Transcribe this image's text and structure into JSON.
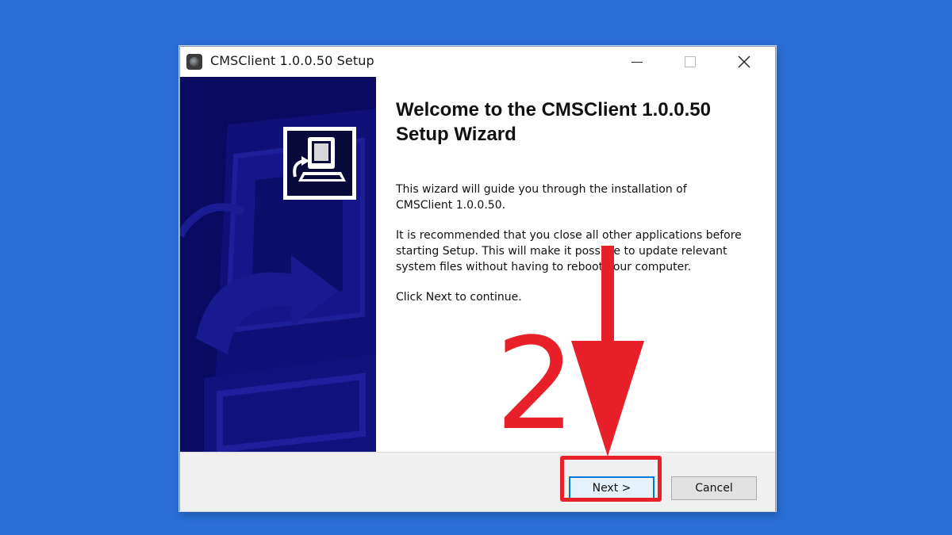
{
  "window": {
    "title": "CMSClient 1.0.0.50 Setup",
    "controls": {
      "minimize": "—",
      "close": "✕"
    }
  },
  "content": {
    "heading_line1": "Welcome to the CMSClient 1.0.0.50",
    "heading_line2": "Setup Wizard",
    "paragraph1": "This wizard will guide you through the installation of CMSClient 1.0.0.50.",
    "paragraph2": "It is recommended that you close all other applications before starting Setup. This will make it possible to update relevant system files without having to reboot your computer.",
    "paragraph3": "Click Next to continue."
  },
  "buttons": {
    "next_label": "Next >",
    "cancel_label": "Cancel"
  },
  "annotation": {
    "step_number": "2",
    "color": "#e8202a"
  },
  "colors": {
    "background": "#2a6fd6",
    "banner": "#0a0a63",
    "accent": "#0078d7"
  },
  "icons": {
    "app": "installer-disc-icon",
    "setup": "computer-install-icon"
  }
}
